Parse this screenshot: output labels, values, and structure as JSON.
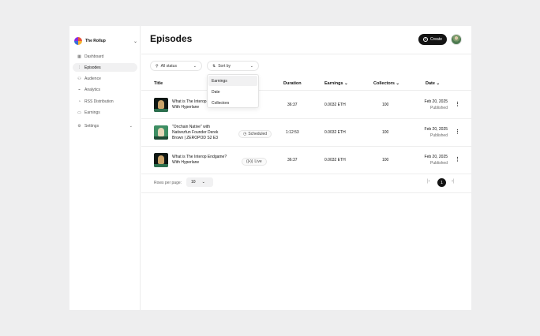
{
  "sidebar": {
    "workspace": "The Rollup",
    "items": [
      {
        "label": "Dashboard",
        "icon": "grid-icon",
        "glyph": "▦"
      },
      {
        "label": "Episodes",
        "icon": "waveform-icon",
        "glyph": "⫶"
      },
      {
        "label": "Audience",
        "icon": "users-icon",
        "glyph": "⚇"
      },
      {
        "label": "Analytics",
        "icon": "chart-icon",
        "glyph": "⌁"
      },
      {
        "label": "RSS Distribution",
        "icon": "rss-icon",
        "glyph": "◔"
      },
      {
        "label": "Earnings",
        "icon": "wallet-icon",
        "glyph": "▭"
      },
      {
        "label": "Settings",
        "icon": "gear-icon",
        "glyph": "⚙"
      }
    ]
  },
  "header": {
    "title": "Episodes",
    "create_label": "Create"
  },
  "filters": {
    "status_label": "All status",
    "sort_label": "Sort by",
    "sort_options": [
      "Earnings",
      "Date",
      "Collectors"
    ]
  },
  "table": {
    "columns": {
      "title": "Title",
      "duration": "Duration",
      "earnings": "Earnings",
      "collectors": "Collectors",
      "date": "Date"
    },
    "rows": [
      {
        "title_line1": "What is The Interop",
        "title_line2": "With Hyperlane",
        "status": "",
        "duration": "36:37",
        "earnings": "0.0032 ETH",
        "collectors": "100",
        "date": "Feb 20, 2025",
        "date_sub": "Published"
      },
      {
        "title_line1": "\"Onchain Native\" with",
        "title_line2": "Nativezfun Founder Derek",
        "title_line3": "Brown | ZEROPOD S2 E3",
        "status": "Scheduled",
        "duration": "1:12:53",
        "earnings": "0.0032 ETH",
        "collectors": "100",
        "date": "Feb 20, 2025",
        "date_sub": "Published"
      },
      {
        "title_line1": "What is The Interop Endgame?",
        "title_line2": "With Hyperlane",
        "status": "Live",
        "duration": "36:37",
        "earnings": "0.0032 ETH",
        "collectors": "100",
        "date": "Feb 20, 2025",
        "date_sub": "Published"
      }
    ]
  },
  "pagination": {
    "rows_per_page_label": "Rows per page:",
    "rows_per_page_value": "10",
    "current_page": "1"
  }
}
